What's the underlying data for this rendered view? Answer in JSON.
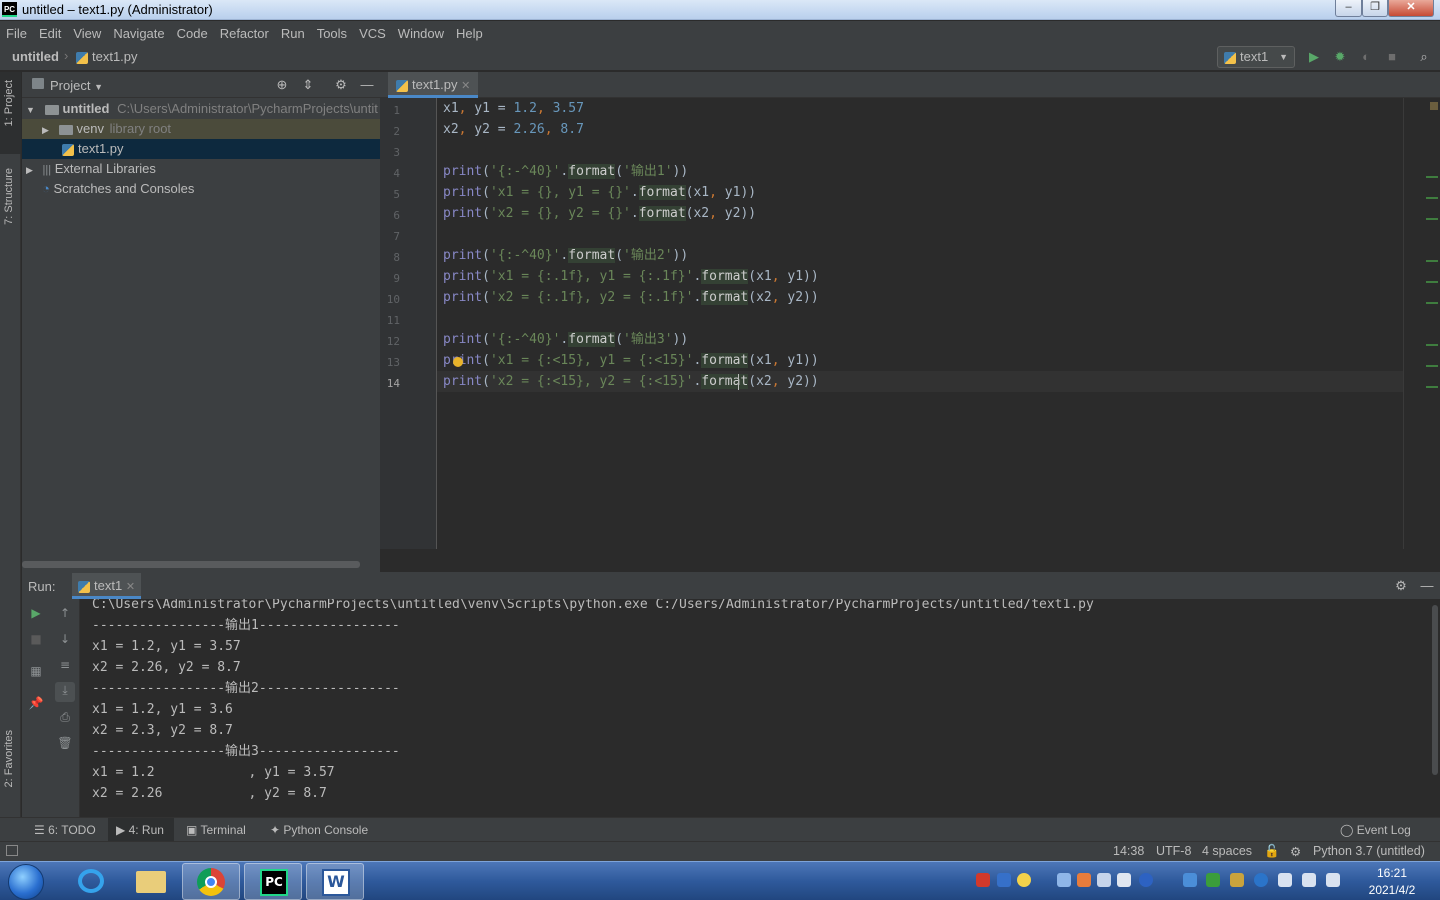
{
  "window": {
    "title": "untitled – text1.py (Administrator)",
    "app_icon": "PC"
  },
  "menu": [
    "File",
    "Edit",
    "View",
    "Navigate",
    "Code",
    "Refactor",
    "Run",
    "Tools",
    "VCS",
    "Window",
    "Help"
  ],
  "breadcrumb": {
    "project": "untitled",
    "file": "text1.py"
  },
  "run_config": {
    "name": "text1"
  },
  "side_tabs": {
    "project": "1: Project",
    "structure": "7: Structure",
    "favorites": "2: Favorites"
  },
  "project_panel": {
    "title": "Project",
    "root": {
      "name": "untitled",
      "path": "C:\\Users\\Administrator\\PycharmProjects\\untit"
    },
    "venv": {
      "name": "venv",
      "hint": "library root"
    },
    "file": "text1.py",
    "external": "External Libraries",
    "scratches": "Scratches and Consoles"
  },
  "editor": {
    "tab": "text1.py",
    "line_numbers": [
      "1",
      "2",
      "3",
      "4",
      "5",
      "6",
      "7",
      "8",
      "9",
      "10",
      "11",
      "12",
      "13",
      "14"
    ],
    "current_line": 14
  },
  "run_panel": {
    "label": "Run:",
    "tab": "text1",
    "output": [
      "C:\\Users\\Administrator\\PycharmProjects\\untitled\\venv\\Scripts\\python.exe C:/Users/Administrator/PycharmProjects/untitled/text1.py",
      "-----------------输出1------------------",
      "x1 = 1.2, y1 = 3.57",
      "x2 = 2.26, y2 = 8.7",
      "-----------------输出2------------------",
      "x1 = 1.2, y1 = 3.6",
      "x2 = 2.3, y2 = 8.7",
      "-----------------输出3------------------",
      "x1 = 1.2            , y1 = 3.57",
      "x2 = 2.26           , y2 = 8.7"
    ]
  },
  "bottom_tabs": [
    "6: TODO",
    "4: Run",
    "Terminal",
    "Python Console"
  ],
  "event_log": "Event Log",
  "status": {
    "position": "14:38",
    "encoding": "UTF-8",
    "indent": "4 spaces",
    "interpreter": "Python 3.7 (untitled)"
  },
  "taskbar": {
    "time": "16:21",
    "date": "2021/4/2"
  },
  "colors": {
    "keyword": "#cc7832",
    "string": "#6a8759",
    "number": "#6897bb",
    "builtin": "#8888c6",
    "accent": "#4a88c7"
  }
}
